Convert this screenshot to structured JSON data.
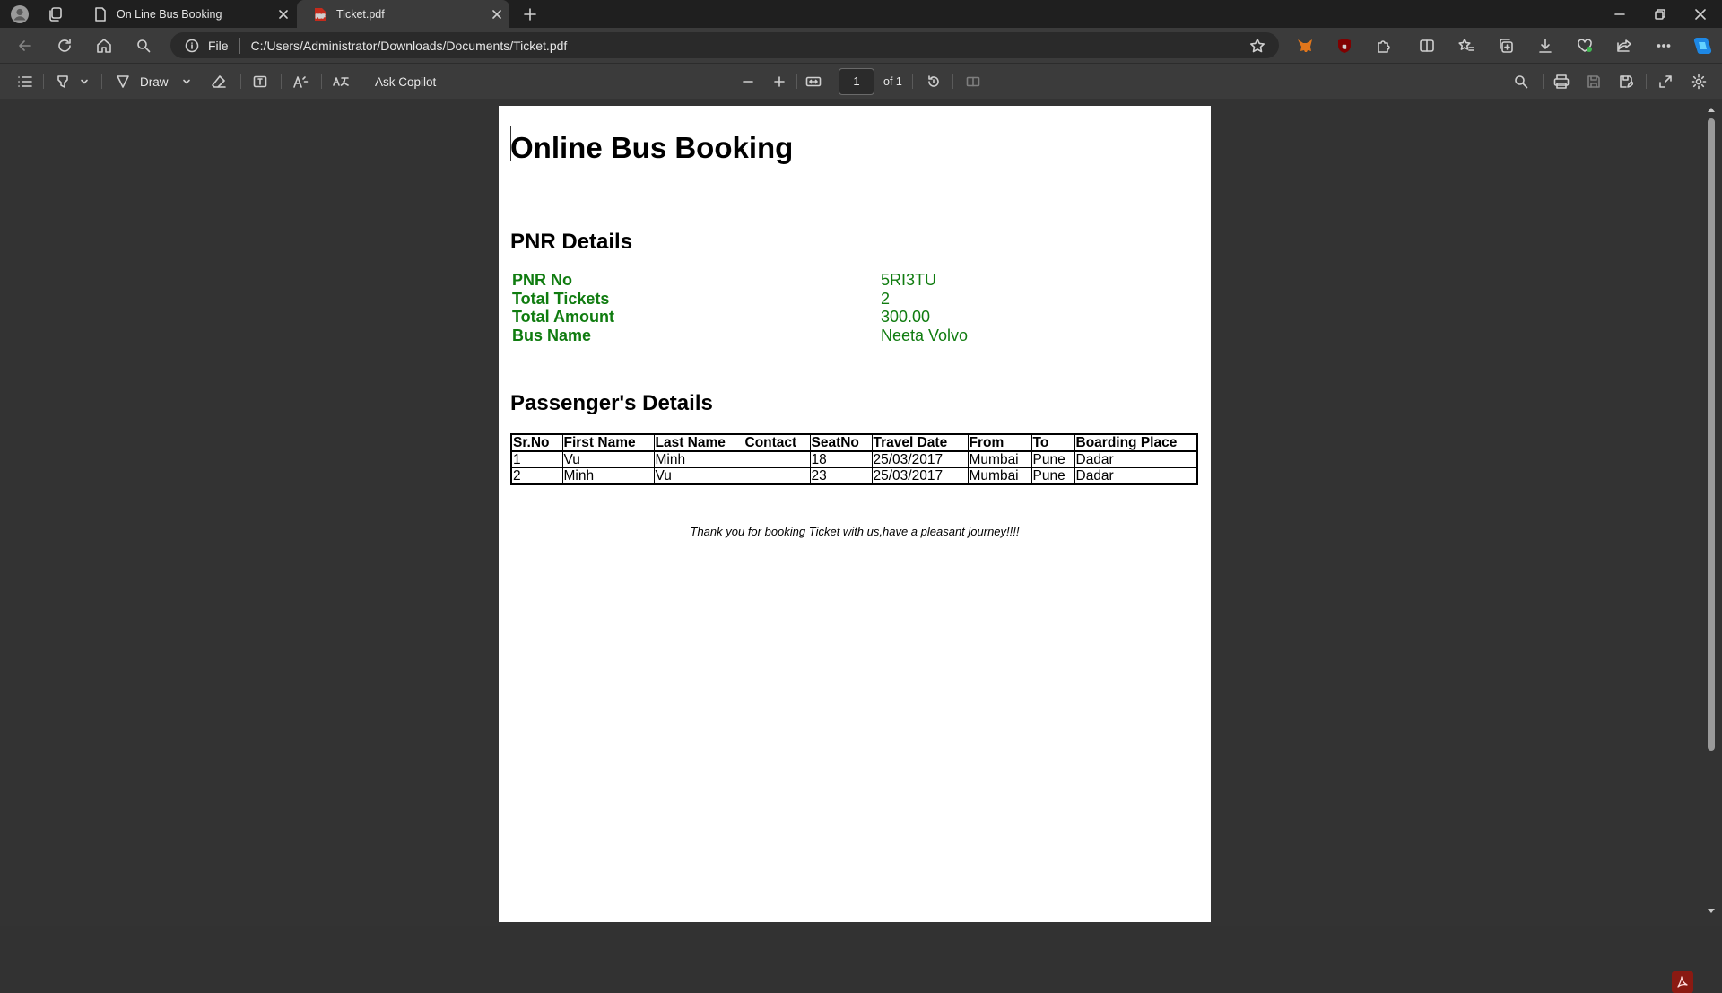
{
  "browser": {
    "tabs": [
      {
        "label": "On Line Bus Booking",
        "active": false,
        "icon": "page-icon"
      },
      {
        "label": "Ticket.pdf",
        "active": true,
        "icon": "pdf-icon"
      }
    ],
    "address": {
      "scheme": "File",
      "url": "C:/Users/Administrator/Downloads/Documents/Ticket.pdf"
    }
  },
  "pdf_toolbar": {
    "draw_label": "Draw",
    "ask_copilot_label": "Ask Copilot",
    "page_current": "1",
    "page_of": "of 1"
  },
  "document": {
    "title": "Online Bus Booking",
    "pnr_heading": "PNR Details",
    "pnr_rows": [
      {
        "label": "PNR No",
        "value": "5RI3TU"
      },
      {
        "label": "Total Tickets",
        "value": "2"
      },
      {
        "label": "Total Amount",
        "value": "300.00"
      },
      {
        "label": "Bus Name",
        "value": "Neeta Volvo"
      }
    ],
    "passenger_heading": "Passenger's Details",
    "table_headers": [
      "Sr.No",
      "First Name",
      "Last Name",
      "Contact",
      "SeatNo",
      "Travel Date",
      "From",
      "To",
      "Boarding Place"
    ],
    "table_rows": [
      [
        "1",
        "Vu",
        "Minh",
        "",
        "18",
        "25/03/2017",
        "Mumbai",
        "Pune",
        "Dadar"
      ],
      [
        "2",
        "Minh",
        "Vu",
        "",
        "23",
        "25/03/2017",
        "Mumbai",
        "Pune",
        "Dadar"
      ]
    ],
    "thanks": "Thank you for booking Ticket with us,have a pleasant journey!!!!"
  },
  "colors": {
    "pnr_green": "#107c10",
    "chrome_dark": "#1f1f1f",
    "chrome": "#3b3b3b",
    "viewer_bg": "#333333"
  }
}
